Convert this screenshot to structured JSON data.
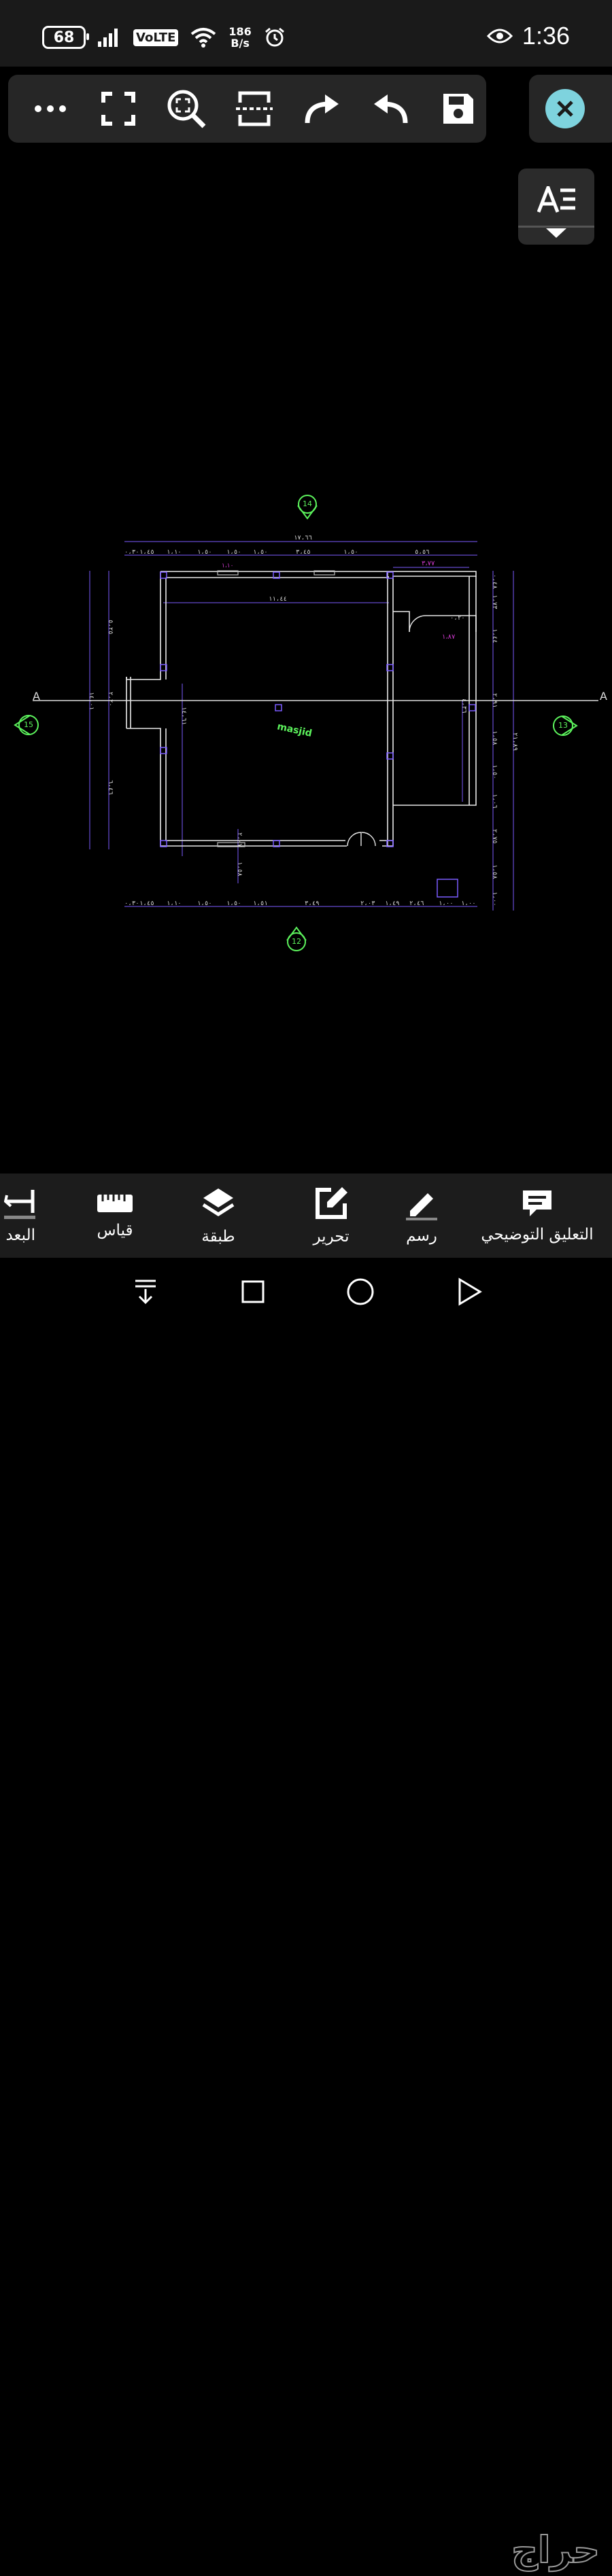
{
  "status_bar": {
    "battery": "68",
    "network_badge": "VoLTE",
    "speed_value": "186",
    "speed_unit": "B/s",
    "clock": "1:36",
    "icons": [
      "signal-icon",
      "wifi-icon",
      "alarm-icon",
      "eye-icon"
    ]
  },
  "toolbar": {
    "buttons": [
      "more-icon",
      "fullscreen-icon",
      "zoom-extents-icon",
      "section-icon",
      "redo-icon",
      "undo-icon",
      "save-icon"
    ]
  },
  "drawing": {
    "label": "masjid",
    "section_left": "A",
    "section_right": "A",
    "markers": {
      "top": "14",
      "left": "15",
      "right": "13",
      "bottom": "12"
    },
    "dims_top_total": "١٧،٦٦",
    "dims_top": [
      "٠،٣٠",
      "١،٤٥",
      "١،١٠",
      "١،٥٠",
      "١،٥٠",
      "١،٥٠",
      "٣،٤٥",
      "١،٥٠",
      "٥،٥٦"
    ],
    "dims_bottom": [
      "٠،٣٠",
      "١،٤٥",
      "١،١٠",
      "١،٥٠",
      "١،٥٠",
      "١،٥١",
      "٣،٤٩",
      "٢،٠٣",
      "١،٤٩",
      "٢،٤٦",
      "١،٠٠",
      "١،٠٠"
    ],
    "dim_inner_top": "١١،٤٤",
    "dim_window": "١،١٠",
    "dim_room": "٣،٧٧",
    "dim_room2": "١،٨٧",
    "dim_small": "٠،٢٠",
    "dims_left": [
      "٥،٢٥",
      "١٤،٠١",
      "٢،٢٠",
      "٦،٤٦"
    ],
    "dim_inner_left": "١٤،٦١",
    "dims_right": [
      "٠،٤٨",
      "١،٧٣",
      "١،٤٤",
      "٢،٩١",
      "١،٥٨",
      "١،٥٠",
      "١،٠٦",
      "٢،٧٥",
      "١،٥٨",
      "١،٠٠"
    ],
    "dim_right_total": "٢١،٨٩",
    "dim_inner_right": "٤،٣٦",
    "dim_bottom_v1": "٢،٠٧",
    "dim_bottom_v2": "١،٥٨"
  },
  "bottom_menu": [
    {
      "label": "التعليق التوضيحي",
      "icon": "comment-icon"
    },
    {
      "label": "رسم",
      "icon": "pencil-icon"
    },
    {
      "label": "تحرير",
      "icon": "edit-icon"
    },
    {
      "label": "طبقة",
      "icon": "layers-icon"
    },
    {
      "label": "قياس",
      "icon": "ruler-icon"
    },
    {
      "label": "البعد",
      "icon": "dimension-icon"
    }
  ],
  "nav_bar": [
    "collapse-icon",
    "recents-icon",
    "home-icon",
    "back-icon"
  ],
  "watermark": "حراج",
  "colors": {
    "accent": "#7ed3de",
    "green": "#5cf25c",
    "magenta": "#d23ad2",
    "purple": "#6a4cff"
  }
}
